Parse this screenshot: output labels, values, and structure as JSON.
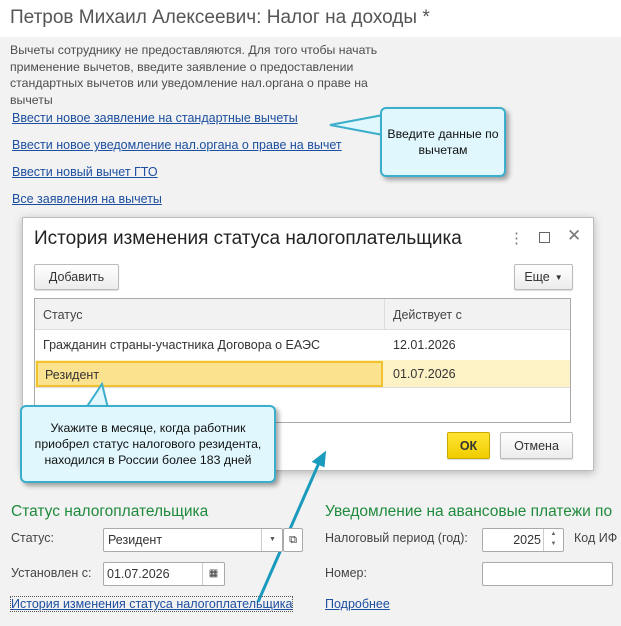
{
  "window": {
    "title": "Петров Михаил Алексеевич: Налог на доходы *"
  },
  "info_text": "Вычеты сотруднику не предоставляются. Для того чтобы начать применение вычетов, введите заявление о предоставлении стандартных вычетов или уведомление нал.органа о праве на вычеты",
  "links": [
    "Ввести новое заявление на стандартные вычеты",
    "Ввести новое уведомление нал.органа о праве на вычет",
    "Ввести новый вычет ГТО",
    "Все заявления на вычеты"
  ],
  "callouts": {
    "deductions": "Введите данные по вычетам",
    "resident": "Укажите в месяце, когда работник приобрел статус налогового резидента, находился в России более 183 дней"
  },
  "dialog": {
    "title": "История изменения статуса налогоплательщика",
    "add_label": "Добавить",
    "more_label": "Еще",
    "ok_label": "ОК",
    "cancel_label": "Отмена",
    "columns": [
      "Статус",
      "Действует с"
    ],
    "rows": [
      {
        "status": "Гражданин страны-участника Договора о ЕАЭС",
        "date": "12.01.2026"
      },
      {
        "status": "Резидент",
        "date": "01.07.2026"
      }
    ]
  },
  "status_section": {
    "title": "Статус налогоплательщика",
    "status_label": "Статус:",
    "status_value": "Резидент",
    "since_label": "Установлен с:",
    "since_value": "01.07.2026",
    "history_link": "История изменения статуса налогоплательщика"
  },
  "advance_section": {
    "title": "Уведомление на авансовые платежи по",
    "period_label": "Налоговый период (год):",
    "period_value": "2025",
    "code_label": "Код ИФ",
    "number_label": "Номер:",
    "number_value": "",
    "more_link": "Подробнее"
  },
  "colors": {
    "accent_callout": "#3aaecb",
    "selected_row": "#fbe28f",
    "ok_button": "#f5d300",
    "section_title": "#1f8a3c",
    "link": "#1d4fa0"
  }
}
